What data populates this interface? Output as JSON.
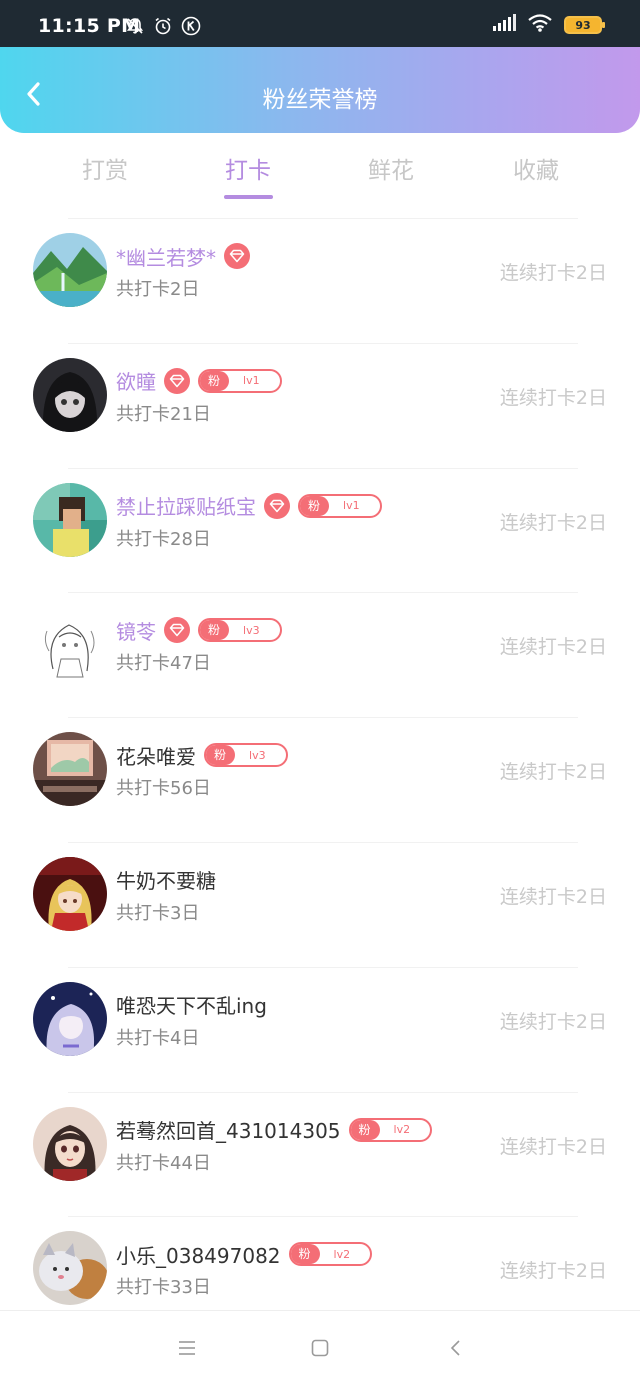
{
  "status_bar": {
    "time": "11:15 PM",
    "battery": "93",
    "icons": [
      "bell-off-icon",
      "alarm-icon",
      "k-app-icon",
      "signal-icon",
      "wifi-icon",
      "battery-icon"
    ]
  },
  "header": {
    "title": "粉丝荣誉榜",
    "back_icon": "chevron-left-icon",
    "gradient": [
      "#4fd6ee",
      "#c299ec"
    ]
  },
  "tabs": [
    {
      "label": "打赏",
      "active": false
    },
    {
      "label": "打卡",
      "active": true
    },
    {
      "label": "鲜花",
      "active": false
    },
    {
      "label": "收藏",
      "active": false
    }
  ],
  "colors": {
    "accent": "#b48ce0",
    "badge": "#f46e76",
    "muted": "#c9c9c9"
  },
  "fans": [
    {
      "name": "*幽兰若梦*",
      "vip": true,
      "diamond": true,
      "fan_badge": null,
      "total": "共打卡2日",
      "streak": "连续打卡2日",
      "avatar": "landscape"
    },
    {
      "name": "欲瞳",
      "vip": true,
      "diamond": true,
      "fan_badge": {
        "label": "粉",
        "level": "lv1"
      },
      "total": "共打卡21日",
      "streak": "连续打卡2日",
      "avatar": "dark-anime"
    },
    {
      "name": "禁止拉踩贴纸宝",
      "vip": true,
      "diamond": true,
      "fan_badge": {
        "label": "粉",
        "level": "lv1"
      },
      "total": "共打卡28日",
      "streak": "连续打卡2日",
      "avatar": "pixel-portrait"
    },
    {
      "name": "镜苓",
      "vip": true,
      "diamond": true,
      "fan_badge": {
        "label": "粉",
        "level": "lv3"
      },
      "total": "共打卡47日",
      "streak": "连续打卡2日",
      "avatar": "sketch"
    },
    {
      "name": "花朵唯爱",
      "vip": false,
      "diamond": false,
      "fan_badge": {
        "label": "粉",
        "level": "lv3"
      },
      "total": "共打卡56日",
      "streak": "连续打卡2日",
      "avatar": "room"
    },
    {
      "name": "牛奶不要糖",
      "vip": false,
      "diamond": false,
      "fan_badge": null,
      "total": "共打卡3日",
      "streak": "连续打卡2日",
      "avatar": "red-girl"
    },
    {
      "name": "唯恐天下不乱ing",
      "vip": false,
      "diamond": false,
      "fan_badge": null,
      "total": "共打卡4日",
      "streak": "连续打卡2日",
      "avatar": "night-anime"
    },
    {
      "name": "若蓦然回首_431014305",
      "vip": false,
      "diamond": false,
      "fan_badge": {
        "label": "粉",
        "level": "lv2"
      },
      "total": "共打卡44日",
      "streak": "连续打卡2日",
      "avatar": "girl-portrait"
    },
    {
      "name": "小乐_038497082",
      "vip": false,
      "diamond": false,
      "fan_badge": {
        "label": "粉",
        "level": "lv2"
      },
      "total": "共打卡33日",
      "streak": "连续打卡2日",
      "avatar": "cat-dog"
    }
  ],
  "nav_bar": {
    "buttons": [
      "menu-icon",
      "home-square-icon",
      "back-triangle-icon"
    ]
  }
}
